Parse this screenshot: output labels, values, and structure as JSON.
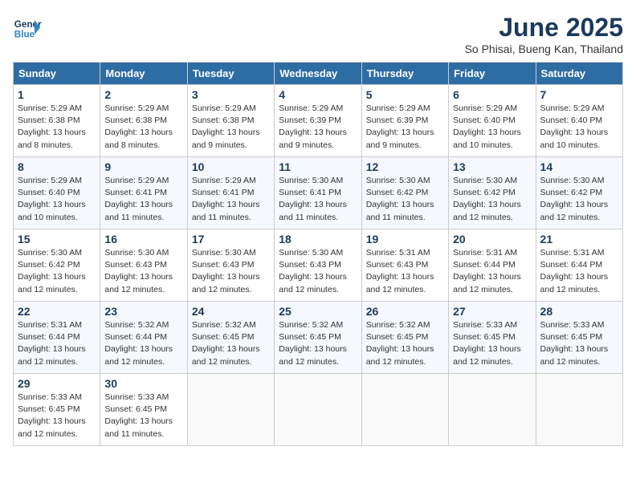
{
  "header": {
    "logo_line1": "General",
    "logo_line2": "Blue",
    "month_title": "June 2025",
    "subtitle": "So Phisai, Bueng Kan, Thailand"
  },
  "days_of_week": [
    "Sunday",
    "Monday",
    "Tuesday",
    "Wednesday",
    "Thursday",
    "Friday",
    "Saturday"
  ],
  "weeks": [
    [
      {
        "day": "1",
        "sunrise": "5:29 AM",
        "sunset": "6:38 PM",
        "daylight": "13 hours and 8 minutes."
      },
      {
        "day": "2",
        "sunrise": "5:29 AM",
        "sunset": "6:38 PM",
        "daylight": "13 hours and 8 minutes."
      },
      {
        "day": "3",
        "sunrise": "5:29 AM",
        "sunset": "6:38 PM",
        "daylight": "13 hours and 9 minutes."
      },
      {
        "day": "4",
        "sunrise": "5:29 AM",
        "sunset": "6:39 PM",
        "daylight": "13 hours and 9 minutes."
      },
      {
        "day": "5",
        "sunrise": "5:29 AM",
        "sunset": "6:39 PM",
        "daylight": "13 hours and 9 minutes."
      },
      {
        "day": "6",
        "sunrise": "5:29 AM",
        "sunset": "6:40 PM",
        "daylight": "13 hours and 10 minutes."
      },
      {
        "day": "7",
        "sunrise": "5:29 AM",
        "sunset": "6:40 PM",
        "daylight": "13 hours and 10 minutes."
      }
    ],
    [
      {
        "day": "8",
        "sunrise": "5:29 AM",
        "sunset": "6:40 PM",
        "daylight": "13 hours and 10 minutes."
      },
      {
        "day": "9",
        "sunrise": "5:29 AM",
        "sunset": "6:41 PM",
        "daylight": "13 hours and 11 minutes."
      },
      {
        "day": "10",
        "sunrise": "5:29 AM",
        "sunset": "6:41 PM",
        "daylight": "13 hours and 11 minutes."
      },
      {
        "day": "11",
        "sunrise": "5:30 AM",
        "sunset": "6:41 PM",
        "daylight": "13 hours and 11 minutes."
      },
      {
        "day": "12",
        "sunrise": "5:30 AM",
        "sunset": "6:42 PM",
        "daylight": "13 hours and 11 minutes."
      },
      {
        "day": "13",
        "sunrise": "5:30 AM",
        "sunset": "6:42 PM",
        "daylight": "13 hours and 12 minutes."
      },
      {
        "day": "14",
        "sunrise": "5:30 AM",
        "sunset": "6:42 PM",
        "daylight": "13 hours and 12 minutes."
      }
    ],
    [
      {
        "day": "15",
        "sunrise": "5:30 AM",
        "sunset": "6:42 PM",
        "daylight": "13 hours and 12 minutes."
      },
      {
        "day": "16",
        "sunrise": "5:30 AM",
        "sunset": "6:43 PM",
        "daylight": "13 hours and 12 minutes."
      },
      {
        "day": "17",
        "sunrise": "5:30 AM",
        "sunset": "6:43 PM",
        "daylight": "13 hours and 12 minutes."
      },
      {
        "day": "18",
        "sunrise": "5:30 AM",
        "sunset": "6:43 PM",
        "daylight": "13 hours and 12 minutes."
      },
      {
        "day": "19",
        "sunrise": "5:31 AM",
        "sunset": "6:43 PM",
        "daylight": "13 hours and 12 minutes."
      },
      {
        "day": "20",
        "sunrise": "5:31 AM",
        "sunset": "6:44 PM",
        "daylight": "13 hours and 12 minutes."
      },
      {
        "day": "21",
        "sunrise": "5:31 AM",
        "sunset": "6:44 PM",
        "daylight": "13 hours and 12 minutes."
      }
    ],
    [
      {
        "day": "22",
        "sunrise": "5:31 AM",
        "sunset": "6:44 PM",
        "daylight": "13 hours and 12 minutes."
      },
      {
        "day": "23",
        "sunrise": "5:32 AM",
        "sunset": "6:44 PM",
        "daylight": "13 hours and 12 minutes."
      },
      {
        "day": "24",
        "sunrise": "5:32 AM",
        "sunset": "6:45 PM",
        "daylight": "13 hours and 12 minutes."
      },
      {
        "day": "25",
        "sunrise": "5:32 AM",
        "sunset": "6:45 PM",
        "daylight": "13 hours and 12 minutes."
      },
      {
        "day": "26",
        "sunrise": "5:32 AM",
        "sunset": "6:45 PM",
        "daylight": "13 hours and 12 minutes."
      },
      {
        "day": "27",
        "sunrise": "5:33 AM",
        "sunset": "6:45 PM",
        "daylight": "13 hours and 12 minutes."
      },
      {
        "day": "28",
        "sunrise": "5:33 AM",
        "sunset": "6:45 PM",
        "daylight": "13 hours and 12 minutes."
      }
    ],
    [
      {
        "day": "29",
        "sunrise": "5:33 AM",
        "sunset": "6:45 PM",
        "daylight": "13 hours and 12 minutes."
      },
      {
        "day": "30",
        "sunrise": "5:33 AM",
        "sunset": "6:45 PM",
        "daylight": "13 hours and 11 minutes."
      },
      null,
      null,
      null,
      null,
      null
    ]
  ]
}
